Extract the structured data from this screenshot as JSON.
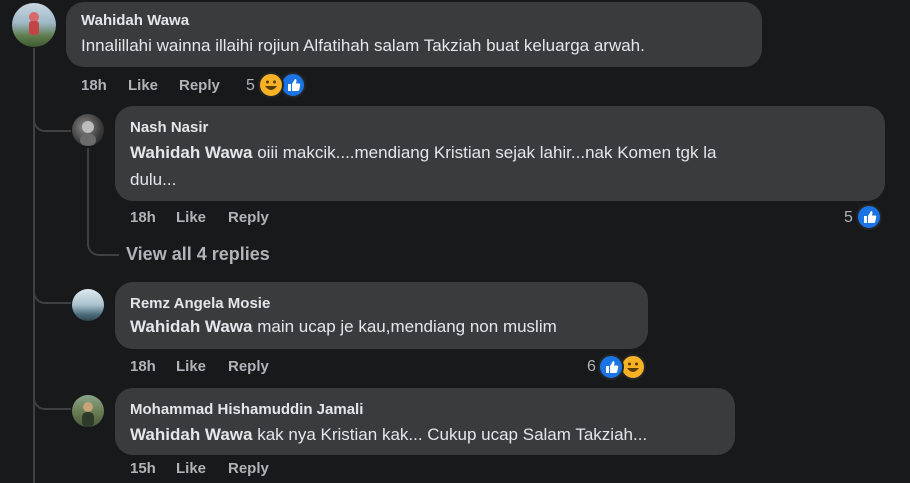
{
  "comment": {
    "author": "Wahidah Wawa",
    "text": "Innalillahi wainna illaihi rojiun Alfatihah salam Takziah buat keluarga arwah.",
    "time": "18h",
    "like_label": "Like",
    "reply_label": "Reply",
    "reaction_count": "5",
    "reactions": [
      "haha-icon",
      "like-icon"
    ]
  },
  "replies": [
    {
      "author": "Nash Nasir",
      "mention": "Wahidah Wawa",
      "text_line1": "oiii makcik....mendiang Kristian sejak lahir...nak Komen tgk la",
      "text_line2": "dulu...",
      "time": "18h",
      "like_label": "Like",
      "reply_label": "Reply",
      "reaction_count": "5",
      "reactions": [
        "like-icon"
      ]
    },
    {
      "author": "Remz Angela Mosie",
      "mention": "Wahidah Wawa",
      "text": "main ucap je kau,mendiang non muslim",
      "time": "18h",
      "like_label": "Like",
      "reply_label": "Reply",
      "reaction_count": "6",
      "reactions": [
        "like-icon",
        "haha-icon"
      ]
    },
    {
      "author": "Mohammad Hishamuddin Jamali",
      "mention": "Wahidah Wawa",
      "text": "kak nya Kristian kak... Cukup ucap Salam Takziah...",
      "time": "15h",
      "like_label": "Like",
      "reply_label": "Reply"
    }
  ],
  "view_replies_label": "View all 4 replies",
  "colors": {
    "background": "#18191a",
    "bubble": "#3a3b3c",
    "text": "#e4e6eb",
    "secondary": "#b0b3b8",
    "like_blue": "#1b74e4",
    "haha_yellow": "#f7b125"
  }
}
